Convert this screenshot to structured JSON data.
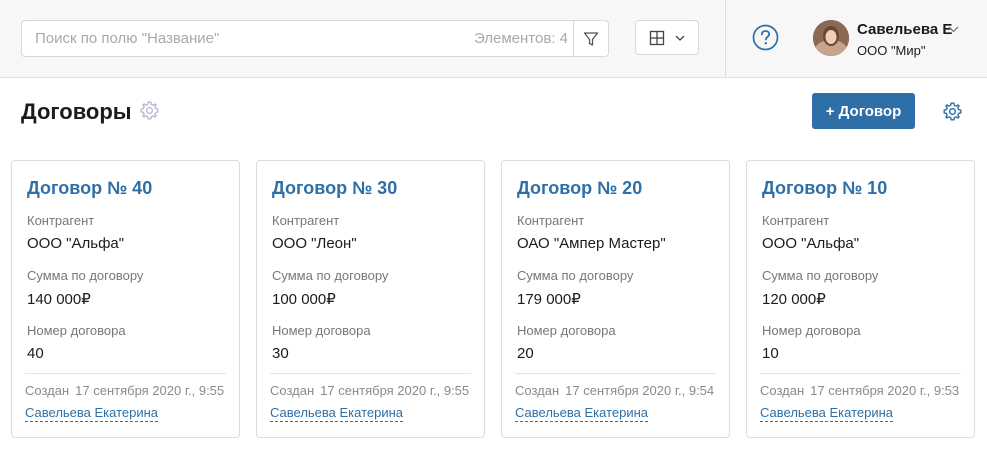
{
  "search": {
    "placeholder": "Поиск по полю \"Название\"",
    "value": "",
    "count_label": "Элементов: 4"
  },
  "user": {
    "name": "Савельева Е",
    "company": "ООО \"Мир\""
  },
  "page": {
    "title": "Договоры",
    "add_button": "+ Договор"
  },
  "labels": {
    "counterparty": "Контрагент",
    "amount": "Сумма по договору",
    "number": "Номер договора",
    "created": "Создан"
  },
  "cards": [
    {
      "title": "Договор № 40",
      "counterparty": "ООО \"Альфа\"",
      "amount": "140 000₽",
      "number": "40",
      "created": "17 сентября 2020 г., 9:55",
      "author": "Савельева Екатерина"
    },
    {
      "title": "Договор № 30",
      "counterparty": "ООО \"Леон\"",
      "amount": "100 000₽",
      "number": "30",
      "created": "17 сентября 2020 г., 9:55",
      "author": "Савельева Екатерина"
    },
    {
      "title": "Договор № 20",
      "counterparty": "ОАО \"Ампер Мастер\"",
      "amount": "179 000₽",
      "number": "20",
      "created": "17 сентября 2020 г., 9:54",
      "author": "Савельева Екатерина"
    },
    {
      "title": "Договор № 10",
      "counterparty": "ООО \"Альфа\"",
      "amount": "120 000₽",
      "number": "10",
      "created": "17 сентября 2020 г., 9:53",
      "author": "Савельева Екатерина"
    }
  ],
  "icons": {
    "filter": "filter-icon",
    "view": "grid-view-icon",
    "help": "help-circle-icon",
    "settings": "gear-icon"
  },
  "colors": {
    "accent": "#2e6fa8",
    "muted": "#777777"
  }
}
